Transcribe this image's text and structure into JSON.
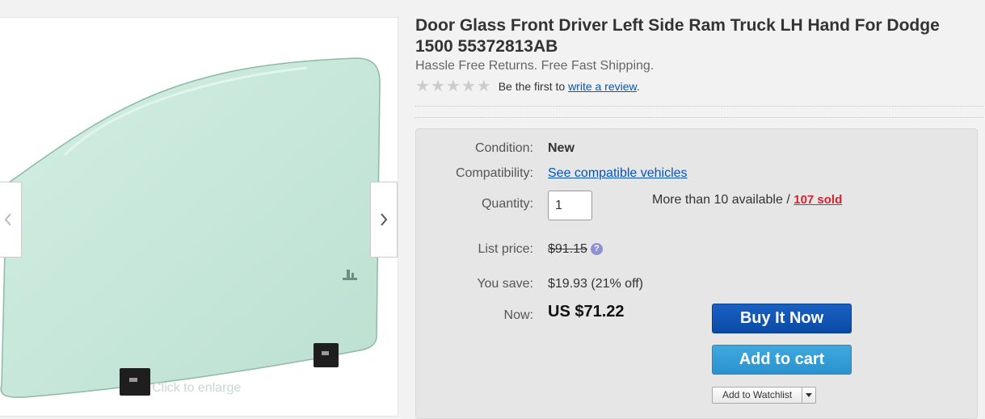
{
  "listing": {
    "title": "Door Glass Front Driver Left Side Ram Truck LH Hand For Dodge 1500 55372813AB",
    "subtitle": "Hassle Free Returns. Free Fast Shipping.",
    "rating": {
      "stars": 0,
      "max_stars": 5,
      "prefix": "Be the first to",
      "link_text": "write a review",
      "suffix": "."
    }
  },
  "gallery": {
    "enlarge_hint": "Click to enlarge",
    "prev_icon": "chevron-left-icon",
    "next_icon": "chevron-right-icon",
    "glass_color": "#c6e7d9"
  },
  "buy_box": {
    "condition": {
      "label": "Condition:",
      "value": "New"
    },
    "compatibility": {
      "label": "Compatibility:",
      "link": "See compatible vehicles"
    },
    "quantity": {
      "label": "Quantity:",
      "value": "1",
      "available": "More than 10 available /",
      "sold": "107 sold"
    },
    "list_price": {
      "label": "List price:",
      "value": "$91.15",
      "help_icon": "?"
    },
    "you_save": {
      "label": "You save:",
      "value": "$19.93 (21% off)"
    },
    "now": {
      "label": "Now:",
      "value": "US $71.22"
    },
    "buttons": {
      "buy_now": "Buy It Now",
      "add_to_cart": "Add to cart",
      "watchlist": "Add to Watchlist"
    }
  },
  "colors": {
    "link": "#0654ba",
    "sold": "#dd1e31",
    "buy_now": "#0a4aa6",
    "add_to_cart": "#2a93cf"
  }
}
